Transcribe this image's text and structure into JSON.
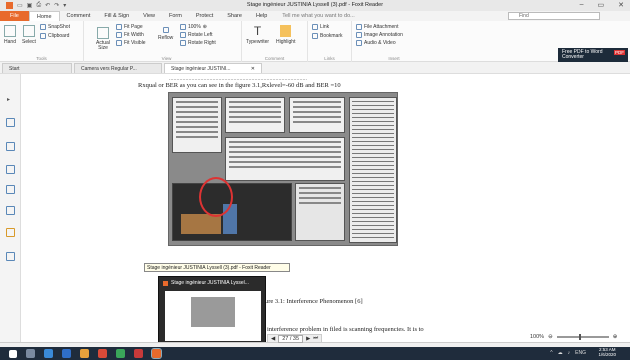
{
  "window": {
    "title": "Stage ingénieur JUSTINIA Lyssell (3).pdf - Foxit Reader",
    "qat_icons": [
      "app-logo-icon",
      "open-icon",
      "save-icon",
      "print-icon",
      "undo-icon",
      "redo-icon",
      "customize-icon"
    ]
  },
  "menu": {
    "file": "File",
    "items": [
      "Home",
      "Comment",
      "Fill & Sign",
      "View",
      "Form",
      "Protect",
      "Share",
      "Help"
    ],
    "tell_me": "Tell me what you want to do...",
    "find_placeholder": "Find"
  },
  "ribbon": {
    "hand": "Hand",
    "select": "Select",
    "snapshot": "SnapShot",
    "clipboard": "Clipboard",
    "actual_size": "Actual Size",
    "fit_page": "Fit Page",
    "fit_width": "Fit Width",
    "fit_visible": "Fit Visible",
    "reflow": "Reflow",
    "zoom": "100%",
    "rotate_left": "Rotate Left",
    "rotate_right": "Rotate Right",
    "typewriter": "Typewriter",
    "highlight": "Highlight",
    "link": "Link",
    "bookmark": "Bookmark",
    "file_attachment": "File Attachment",
    "image_annotation": "Image Annotation",
    "audio_video": "Audio & Video",
    "groups": {
      "tools": "Tools",
      "view": "View",
      "comment": "Comment",
      "links": "Links",
      "insert": "Insert"
    }
  },
  "promo": {
    "line1": "Free PDF to Word",
    "line2": "Converter",
    "badge": "PDF"
  },
  "tabs": [
    {
      "label": "Start"
    },
    {
      "label": "Camera vers Regular P..."
    },
    {
      "label": "Stage ingénieur JUSTINI..."
    }
  ],
  "document": {
    "line1": "Rxqual or BER as you can see in the figure 3.1,Rxlevel=-60 dB and BER =10",
    "caption": "ure 3.1: Interference Phenomenon [6]",
    "body": "interference problem in filed is scanning frequencies. It is to"
  },
  "tooltip": "Stage ingénieur JUSTINIA Lyssell (3).pdf - Foxit Reader",
  "thumbnail": {
    "title": "Stage ingénieur JUSTINIA Lyssel..."
  },
  "pagenav": {
    "current": "27 / 35"
  },
  "zoom": {
    "level": "100%"
  },
  "clock": {
    "time": "2:53 AM",
    "date": "1/6/2020"
  },
  "tray": {
    "lang": "ENG"
  }
}
